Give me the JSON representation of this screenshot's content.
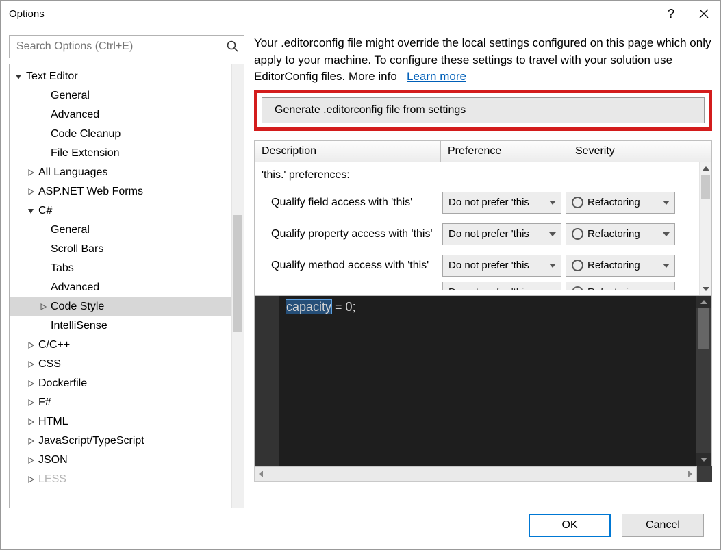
{
  "window": {
    "title": "Options"
  },
  "search": {
    "placeholder": "Search Options (Ctrl+E)"
  },
  "tree": {
    "root": "Text Editor",
    "items": [
      {
        "label": "General",
        "indent": 2,
        "arrow": "none"
      },
      {
        "label": "Advanced",
        "indent": 2,
        "arrow": "none"
      },
      {
        "label": "Code Cleanup",
        "indent": 2,
        "arrow": "none"
      },
      {
        "label": "File Extension",
        "indent": 2,
        "arrow": "none"
      },
      {
        "label": "All Languages",
        "indent": 1,
        "arrow": "right"
      },
      {
        "label": "ASP.NET Web Forms",
        "indent": 1,
        "arrow": "right"
      },
      {
        "label": "C#",
        "indent": 1,
        "arrow": "down"
      },
      {
        "label": "General",
        "indent": 3,
        "arrow": "none"
      },
      {
        "label": "Scroll Bars",
        "indent": 3,
        "arrow": "none"
      },
      {
        "label": "Tabs",
        "indent": 3,
        "arrow": "none"
      },
      {
        "label": "Advanced",
        "indent": 3,
        "arrow": "none"
      },
      {
        "label": "Code Style",
        "indent": 3,
        "arrow": "right",
        "selected": true
      },
      {
        "label": "IntelliSense",
        "indent": 3,
        "arrow": "none"
      },
      {
        "label": "C/C++",
        "indent": 1,
        "arrow": "right"
      },
      {
        "label": "CSS",
        "indent": 1,
        "arrow": "right"
      },
      {
        "label": "Dockerfile",
        "indent": 1,
        "arrow": "right"
      },
      {
        "label": "F#",
        "indent": 1,
        "arrow": "right"
      },
      {
        "label": "HTML",
        "indent": 1,
        "arrow": "right"
      },
      {
        "label": "JavaScript/TypeScript",
        "indent": 1,
        "arrow": "right"
      },
      {
        "label": "JSON",
        "indent": 1,
        "arrow": "right"
      },
      {
        "label": "LESS",
        "indent": 1,
        "arrow": "right",
        "faded": true
      }
    ]
  },
  "notice": {
    "text": "Your .editorconfig file might override the local settings configured on this page which only apply to your machine. To configure these settings to travel with your solution use EditorConfig files. More info",
    "link": "Learn more"
  },
  "generate_button": "Generate .editorconfig file from settings",
  "grid": {
    "headers": {
      "desc": "Description",
      "pref": "Preference",
      "sev": "Severity"
    },
    "group": "'this.' preferences:",
    "rows": [
      {
        "desc": "Qualify field access with 'this'",
        "pref": "Do not prefer 'this",
        "sev": "Refactoring"
      },
      {
        "desc": "Qualify property access with 'this'",
        "pref": "Do not prefer 'this",
        "sev": "Refactoring"
      },
      {
        "desc": "Qualify method access with 'this'",
        "pref": "Do not prefer 'this",
        "sev": "Refactoring"
      },
      {
        "desc": "",
        "pref": "Do not prefer 'this",
        "sev": "Refactoring"
      }
    ]
  },
  "code": {
    "token_hl": "capacity",
    "rest": " = 0;"
  },
  "footer": {
    "ok": "OK",
    "cancel": "Cancel"
  }
}
